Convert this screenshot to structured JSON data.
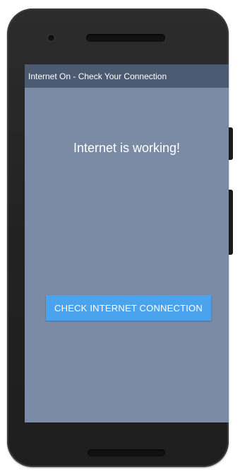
{
  "app": {
    "title": "Internet On - Check Your Connection"
  },
  "main": {
    "status_text": "Internet is working!",
    "check_button_label": "CHECK INTERNET CONNECTION"
  },
  "colors": {
    "screen_background": "#7b8ba6",
    "appbar_background": "#4d5b72",
    "button_background": "#4aa3ec",
    "text": "#ffffff"
  }
}
